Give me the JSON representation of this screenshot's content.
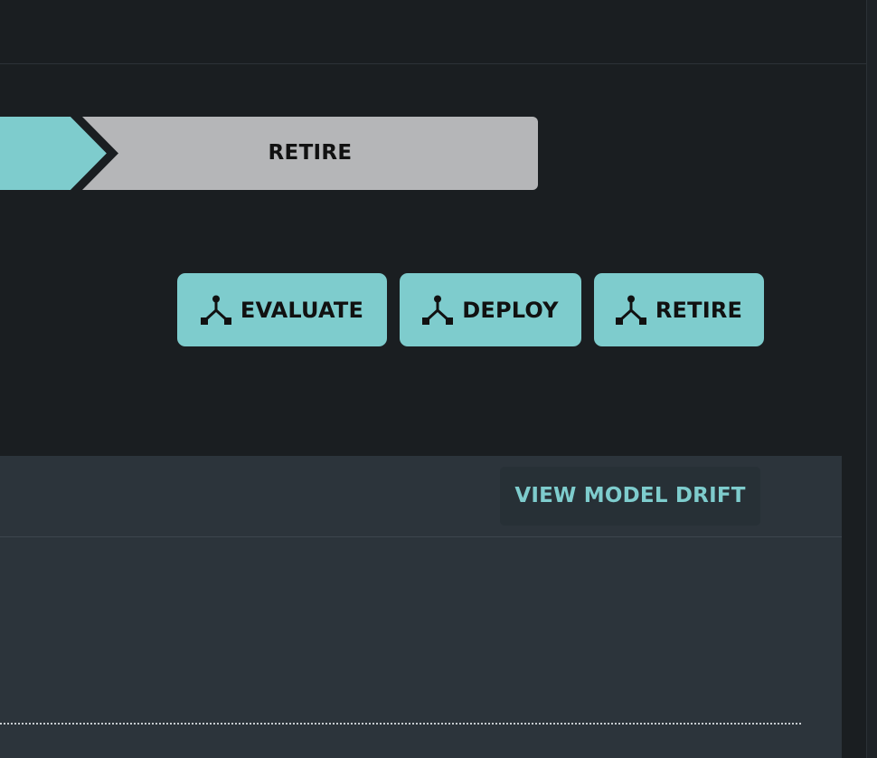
{
  "pipeline": {
    "stages": [
      {
        "label": "",
        "state": "active"
      },
      {
        "label": "RETIRE",
        "state": "pending"
      }
    ]
  },
  "actions": [
    {
      "label": "EVALUATE",
      "icon": "fork-icon"
    },
    {
      "label": "DEPLOY",
      "icon": "fork-icon"
    },
    {
      "label": "RETIRE",
      "icon": "fork-icon"
    }
  ],
  "panel": {
    "drift_button_label": "VIEW MODEL DRIFT"
  },
  "colors": {
    "background": "#1a1e21",
    "accent": "#7ecccd",
    "stage_pending": "#b5b6b8",
    "panel": "#2c343b"
  }
}
